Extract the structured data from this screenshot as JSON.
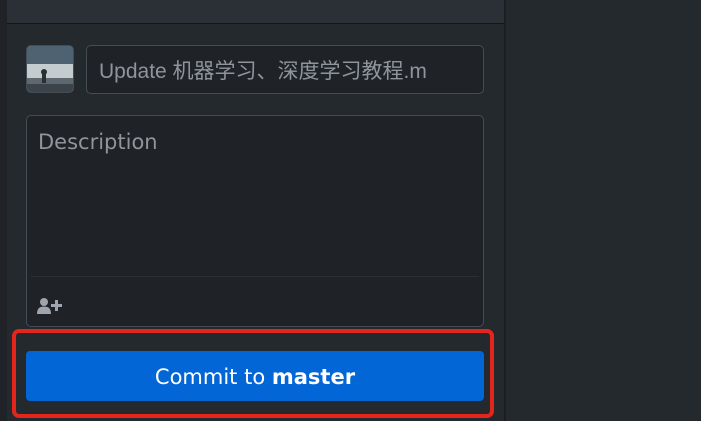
{
  "commit": {
    "summary_value": "Update 机器学习、深度学习教程.m",
    "description_placeholder": "Description",
    "button_prefix": "Commit to ",
    "button_branch": "master"
  },
  "icons": {
    "avatar": "user-avatar",
    "coauthor": "add-coauthor-icon"
  },
  "colors": {
    "accent": "#0366d6",
    "highlight": "#e3251b",
    "background": "#24292e"
  }
}
